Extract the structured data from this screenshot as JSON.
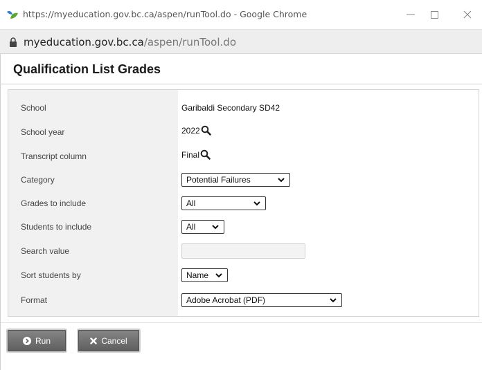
{
  "window": {
    "title": "https://myeducation.gov.bc.ca/aspen/runTool.do - Google Chrome",
    "url_domain": "myeducation.gov.bc.ca",
    "url_path": "/aspen/runTool.do"
  },
  "page": {
    "title": "Qualification List Grades"
  },
  "form": {
    "school": {
      "label": "School",
      "value": "Garibaldi Secondary SD42"
    },
    "school_year": {
      "label": "School year",
      "value": "2022"
    },
    "transcript_column": {
      "label": "Transcript column",
      "value": "Final"
    },
    "category": {
      "label": "Category",
      "selected": "Potential Failures"
    },
    "grades_to_include": {
      "label": "Grades to include",
      "selected": "All"
    },
    "students_to_include": {
      "label": "Students to include",
      "selected": "All"
    },
    "search_value": {
      "label": "Search value",
      "value": ""
    },
    "sort_students_by": {
      "label": "Sort students by",
      "selected": "Name"
    },
    "format": {
      "label": "Format",
      "selected": "Adobe Acrobat (PDF)"
    }
  },
  "buttons": {
    "run": "Run",
    "cancel": "Cancel"
  },
  "icons": {
    "app": "chrome-app-icon",
    "lock": "lock-icon",
    "lookup": "magnifier-icon",
    "run": "play-circle-icon",
    "cancel": "x-icon"
  },
  "colors": {
    "label_column_bg": "#f1f1f1",
    "button_bg": "#6e6e6e",
    "address_bar_bg": "#eeeeee"
  }
}
